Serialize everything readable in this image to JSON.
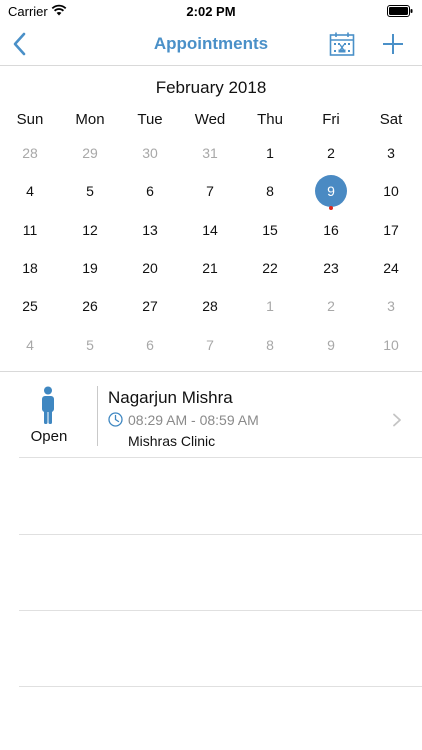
{
  "status_bar": {
    "carrier": "Carrier",
    "time": "2:02 PM",
    "wifi_icon": "wifi-icon",
    "battery_icon": "battery-icon"
  },
  "nav": {
    "title": "Appointments",
    "back_icon": "chevron-left-icon",
    "calendar_icon": "calendar-icon",
    "add_icon": "plus-icon",
    "accent_color": "#4a90c8"
  },
  "calendar": {
    "month_label": "February 2018",
    "weekdays": [
      "Sun",
      "Mon",
      "Tue",
      "Wed",
      "Thu",
      "Fri",
      "Sat"
    ],
    "selected_day": "9",
    "selected_color": "#4a8ac3",
    "event_dot_color": "#e0271d",
    "weeks": [
      [
        {
          "d": "28",
          "m": true
        },
        {
          "d": "29",
          "m": true
        },
        {
          "d": "30",
          "m": true
        },
        {
          "d": "31",
          "m": true
        },
        {
          "d": "1",
          "m": false
        },
        {
          "d": "2",
          "m": false
        },
        {
          "d": "3",
          "m": false
        }
      ],
      [
        {
          "d": "4",
          "m": false
        },
        {
          "d": "5",
          "m": false
        },
        {
          "d": "6",
          "m": false
        },
        {
          "d": "7",
          "m": false
        },
        {
          "d": "8",
          "m": false
        },
        {
          "d": "9",
          "m": false,
          "selected": true,
          "event": true
        },
        {
          "d": "10",
          "m": false
        }
      ],
      [
        {
          "d": "11",
          "m": false
        },
        {
          "d": "12",
          "m": false
        },
        {
          "d": "13",
          "m": false
        },
        {
          "d": "14",
          "m": false
        },
        {
          "d": "15",
          "m": false
        },
        {
          "d": "16",
          "m": false
        },
        {
          "d": "17",
          "m": false
        }
      ],
      [
        {
          "d": "18",
          "m": false
        },
        {
          "d": "19",
          "m": false
        },
        {
          "d": "20",
          "m": false
        },
        {
          "d": "21",
          "m": false
        },
        {
          "d": "22",
          "m": false
        },
        {
          "d": "23",
          "m": false
        },
        {
          "d": "24",
          "m": false
        }
      ],
      [
        {
          "d": "25",
          "m": false
        },
        {
          "d": "26",
          "m": false
        },
        {
          "d": "27",
          "m": false
        },
        {
          "d": "28",
          "m": false
        },
        {
          "d": "1",
          "m": true
        },
        {
          "d": "2",
          "m": true
        },
        {
          "d": "3",
          "m": true
        }
      ],
      [
        {
          "d": "4",
          "m": true
        },
        {
          "d": "5",
          "m": true
        },
        {
          "d": "6",
          "m": true
        },
        {
          "d": "7",
          "m": true
        },
        {
          "d": "8",
          "m": true
        },
        {
          "d": "9",
          "m": true
        },
        {
          "d": "10",
          "m": true
        }
      ]
    ]
  },
  "appointments": [
    {
      "status": "Open",
      "status_icon": "person-icon",
      "patient_name": "Nagarjun Mishra",
      "time_range": "08:29 AM - 08:59 AM",
      "clinic": "Mishras Clinic",
      "accent_color": "#3f87c1"
    }
  ]
}
